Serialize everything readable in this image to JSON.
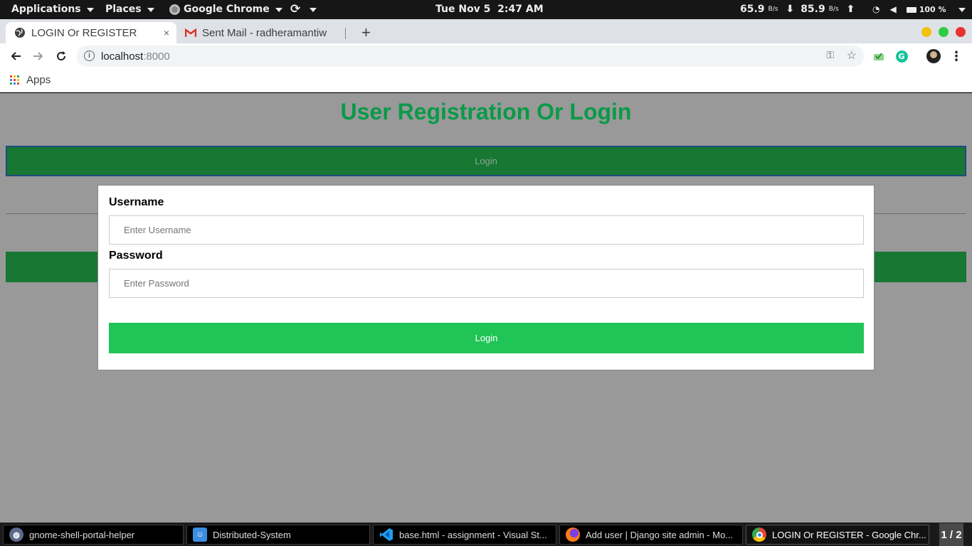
{
  "topbar": {
    "applications": "Applications",
    "places": "Places",
    "app_name": "Google Chrome",
    "clock": "Tue Nov 5  2:47 AM",
    "net_down_value": "65.9",
    "net_down_unit": "B/s",
    "net_up_value": "85.9",
    "net_up_unit": "B/s",
    "battery": "100 %"
  },
  "browser": {
    "tabs": [
      {
        "title": "LOGIN Or REGISTER",
        "close": "×"
      },
      {
        "title": "Sent Mail - radheramantiw"
      }
    ],
    "new_tab": "+",
    "address": {
      "host": "localhost",
      "port": ":8000"
    },
    "bookmarks": {
      "apps": "Apps"
    }
  },
  "page": {
    "heading": "User Registration Or Login",
    "login_bar": "Login",
    "form": {
      "username_label": "Username",
      "username_placeholder": "Enter Username",
      "password_label": "Password",
      "password_placeholder": "Enter Password",
      "submit": "Login"
    }
  },
  "taskbar": {
    "items": [
      "gnome-shell-portal-helper",
      "Distributed-System",
      "base.html - assignment - Visual St...",
      "Add user | Django site admin - Mo...",
      "LOGIN Or REGISTER - Google Chr..."
    ],
    "workspace": "1 / 2"
  },
  "colors": {
    "heading_green": "#0a9a48",
    "bar_green": "#177733",
    "button_green": "#21c456",
    "overlay_gray": "#999999"
  }
}
